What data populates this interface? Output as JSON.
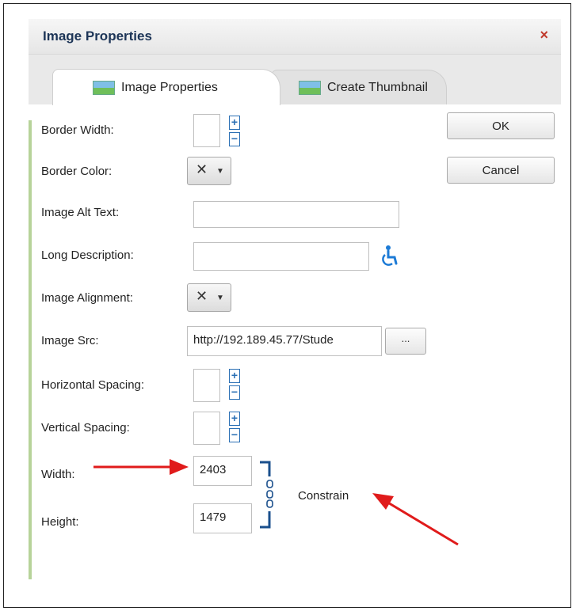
{
  "dialog": {
    "title": "Image Properties",
    "close_label": "×"
  },
  "tabs": [
    {
      "label": "Image Properties",
      "active": true
    },
    {
      "label": "Create Thumbnail",
      "active": false
    }
  ],
  "form": {
    "border_width_label": "Border Width:",
    "border_color_label": "Border Color:",
    "alt_text_label": "Image Alt Text:",
    "long_desc_label": "Long Description:",
    "alignment_label": "Image Alignment:",
    "src_label": "Image Src:",
    "src_value": "http://192.189.45.77/Stude",
    "browse_label": "...",
    "hspace_label": "Horizontal Spacing:",
    "vspace_label": "Vertical Spacing:",
    "width_label": "Width:",
    "width_value": "2403",
    "height_label": "Height:",
    "height_value": "1479",
    "constrain_label": "Constrain",
    "stepper_plus": "+",
    "stepper_minus": "−",
    "dropdown_none": "✕",
    "dropdown_caret": "▼"
  },
  "buttons": {
    "ok_label": "OK",
    "cancel_label": "Cancel"
  },
  "colors": {
    "annotation_arrow": "#e01b1b",
    "stepper_blue": "#2a6fb4",
    "title_text": "#1d3557"
  },
  "icons": {
    "close": "close-icon",
    "image_tab": "image-icon",
    "thumbnail_tab": "thumbnail-icon",
    "accessibility": "accessibility-icon",
    "constrain_link": "link-chain-icon"
  }
}
